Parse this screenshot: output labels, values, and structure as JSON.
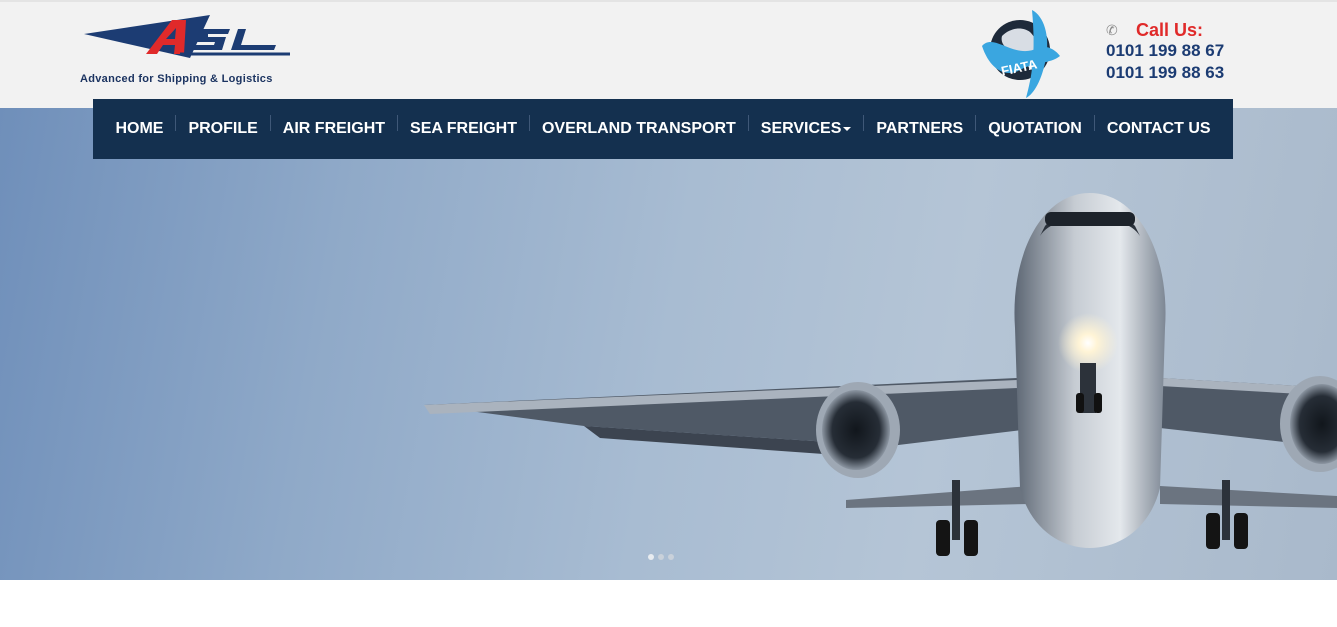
{
  "logo": {
    "mark_text": "ASL",
    "tagline": "Advanced for Shipping & Logistics"
  },
  "partner_logo": {
    "text": "FIATA"
  },
  "contact": {
    "call_label": "Call Us:",
    "phones": [
      "0101 199 88 67",
      "0101 199 88 63"
    ],
    "icon": "phone-icon"
  },
  "nav": {
    "items": [
      {
        "label": "HOME"
      },
      {
        "label": "PROFILE"
      },
      {
        "label": "AIR FREIGHT"
      },
      {
        "label": "SEA FREIGHT"
      },
      {
        "label": "OVERLAND TRANSPORT"
      },
      {
        "label": "SERVICES",
        "dropdown": true
      },
      {
        "label": "PARTNERS"
      },
      {
        "label": "QUOTATION"
      },
      {
        "label": "CONTACT US"
      }
    ]
  },
  "slider": {
    "slide_count": 3,
    "active_index": 0
  },
  "colors": {
    "nav_bg": "#14304f",
    "brand_blue": "#1c3c73",
    "brand_red": "#e02a2a",
    "fiata_blue": "#3aa6e0"
  }
}
